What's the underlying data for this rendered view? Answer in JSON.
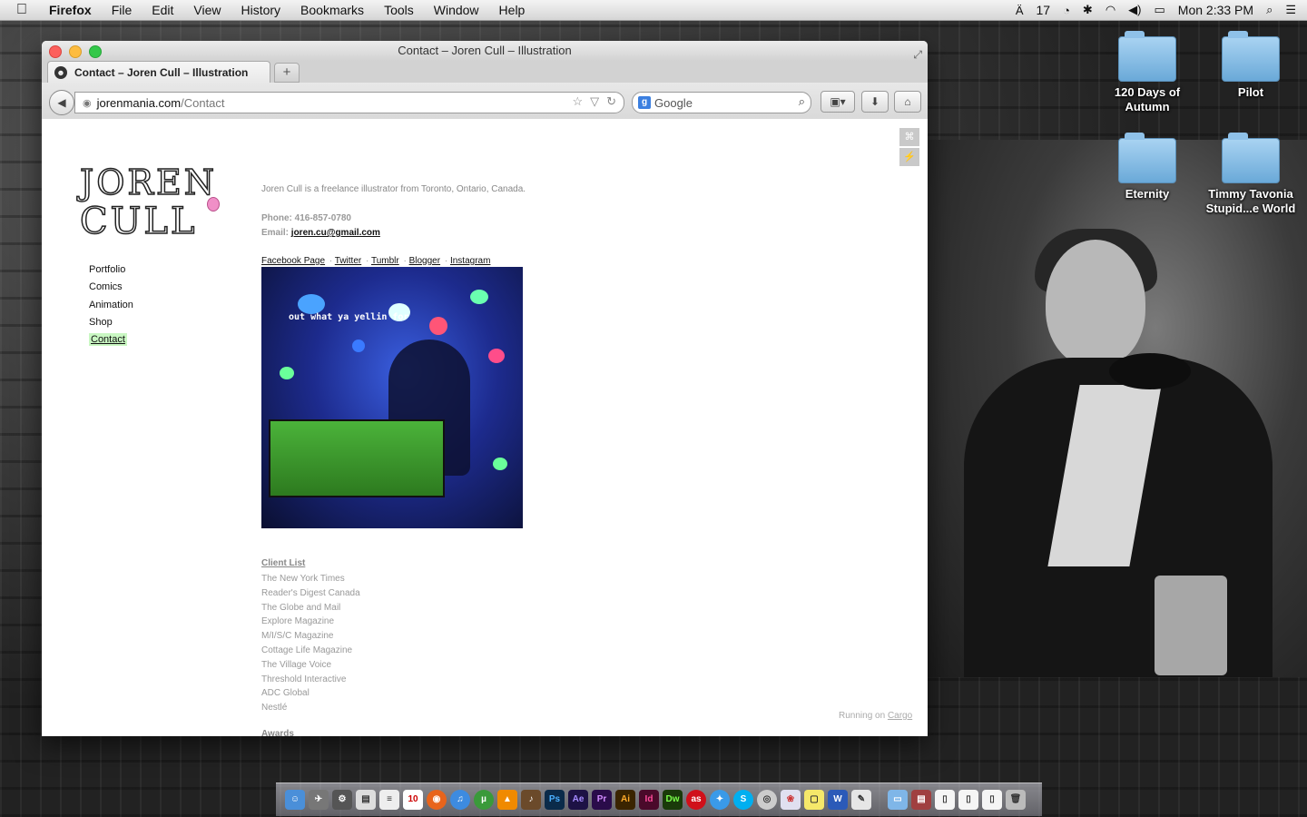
{
  "menubar": {
    "apple": "",
    "app_name": "Firefox",
    "menus": [
      "File",
      "Edit",
      "View",
      "History",
      "Bookmarks",
      "Tools",
      "Window",
      "Help"
    ],
    "status_counter": "17",
    "clock": "Mon 2:33 PM"
  },
  "desktop_icons": [
    {
      "label": "120 Days of Autumn"
    },
    {
      "label": "Pilot"
    },
    {
      "label": "Eternity"
    },
    {
      "label": "Timmy Tavonia Stupid...e World"
    }
  ],
  "window": {
    "title": "Contact – Joren Cull – Illustration",
    "tab_label": "Contact – Joren Cull – Illustration",
    "new_tab": "+",
    "url_domain": "jorenmania.com",
    "url_path": "/Contact",
    "search_engine": "Google",
    "search_placeholder": "Google"
  },
  "page": {
    "logo_line1": "JOREN",
    "logo_line2": "CULL",
    "nav": [
      "Portfolio",
      "Comics",
      "Animation",
      "Shop",
      "Contact"
    ],
    "active_nav": "Contact",
    "intro": "Joren Cull is a freelance illustrator from Toronto, Ontario, Canada.",
    "phone_label": "Phone:",
    "phone": "416-857-0780",
    "email_label": "Email:",
    "email": "joren.cu@gmail.com",
    "social_links": [
      "Facebook Page",
      "Twitter",
      "Tumblr",
      "Blogger",
      "Instagram"
    ],
    "photo_caption": "out what ya yellin for",
    "client_heading": "Client List",
    "clients": [
      "The New York Times",
      "Reader's Digest Canada",
      "The Globe and Mail",
      "Explore Magazine",
      "M/I/S/C Magazine",
      "Cottage Life Magazine",
      "The Village Voice",
      "Threshold Interactive",
      "ADC Global",
      "Nestlé"
    ],
    "awards_heading": "Awards",
    "footer_prefix": "Running on",
    "footer_link": "Cargo"
  },
  "dock_apps": [
    "Finder",
    "Launchpad",
    "System",
    "Preview",
    "Notes",
    "Calendar",
    "Firefox",
    "iTunes",
    "uTorrent",
    "VLC",
    "Guitar",
    "Ps",
    "Ae",
    "Pr",
    "Ai",
    "Id",
    "Dw",
    "Last.fm",
    "Safari",
    "Skype",
    "DVD",
    "Photos",
    "Stickies",
    "Word",
    "Script",
    "Folder",
    "Stack",
    "Docs",
    "Doc2",
    "Doc3",
    "Trash"
  ]
}
